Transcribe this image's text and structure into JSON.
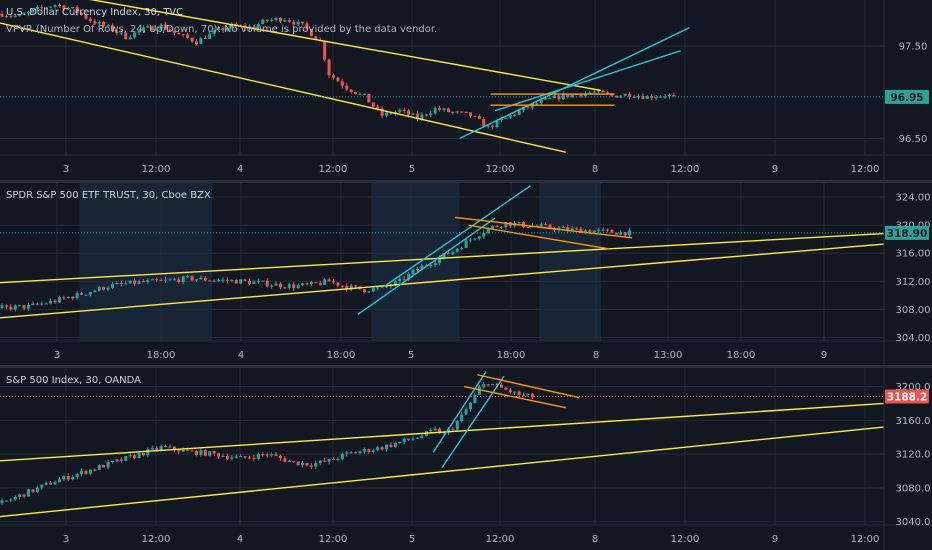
{
  "chart_data": [
    {
      "type": "candlestick",
      "title": "U.S. Dollar Currency Index, 30, TVC",
      "subtitle": "VPVR (Number Of Rows, 24, Up/Down, 70): No volume is provided by the data vendor.",
      "x_tick_labels": [
        "3",
        "12:00",
        "4",
        "12:00",
        "5",
        "12:00",
        "8",
        "12:00",
        "9",
        "12:00"
      ],
      "y_tick_labels": [
        "97.50",
        "96.95",
        "96.50"
      ],
      "y_range": [
        96.32,
        98.0
      ],
      "last_price": "96.95",
      "last_price_value": 96.95,
      "last_price_color": "#26a69a",
      "price_path": [
        [
          0,
          97.85
        ],
        [
          4,
          97.82
        ],
        [
          8,
          97.9
        ],
        [
          12,
          97.95
        ],
        [
          16,
          97.9
        ],
        [
          20,
          97.78
        ],
        [
          24,
          97.7
        ],
        [
          28,
          97.6
        ],
        [
          32,
          97.68
        ],
        [
          36,
          97.72
        ],
        [
          40,
          97.62
        ],
        [
          44,
          97.55
        ],
        [
          48,
          97.65
        ],
        [
          52,
          97.72
        ],
        [
          56,
          97.7
        ],
        [
          60,
          97.78
        ],
        [
          64,
          97.8
        ],
        [
          68,
          97.72
        ],
        [
          72,
          97.55
        ],
        [
          74,
          97.2
        ],
        [
          78,
          97.05
        ],
        [
          82,
          96.95
        ],
        [
          86,
          96.75
        ],
        [
          90,
          96.8
        ],
        [
          94,
          96.72
        ],
        [
          98,
          96.82
        ],
        [
          102,
          96.78
        ],
        [
          106,
          96.75
        ],
        [
          110,
          96.62
        ],
        [
          114,
          96.72
        ],
        [
          118,
          96.82
        ],
        [
          122,
          96.9
        ],
        [
          126,
          96.95
        ],
        [
          130,
          96.98
        ],
        [
          134,
          97.0
        ],
        [
          138,
          96.96
        ],
        [
          142,
          96.98
        ],
        [
          146,
          96.95
        ],
        [
          150,
          96.97
        ],
        [
          152,
          96.95
        ]
      ],
      "trendlines": [
        {
          "color": "#ffeb3b",
          "points": [
            [
              0,
              98.18
            ],
            [
              136,
              97.02
            ]
          ]
        },
        {
          "color": "#ffeb3b",
          "points": [
            [
              0,
              97.75
            ],
            [
              128,
              96.35
            ]
          ]
        },
        {
          "color": "#26c6da",
          "points": [
            [
              104,
              96.5
            ],
            [
              156,
              97.7
            ]
          ]
        },
        {
          "color": "#26c6da",
          "points": [
            [
              112,
              96.8
            ],
            [
              154,
              97.45
            ]
          ]
        },
        {
          "color": "#ff9800",
          "points": [
            [
              111,
              96.98
            ],
            [
              139,
              96.98
            ]
          ]
        },
        {
          "color": "#ff9800",
          "points": [
            [
              111,
              96.86
            ],
            [
              139,
              96.86
            ]
          ]
        }
      ],
      "session_bands": []
    },
    {
      "type": "candlestick",
      "title": "SPDR S&P 500 ETF TRUST, 30, Cboe BZX",
      "x_tick_labels": [
        "3",
        "18:00",
        "4",
        "18:00",
        "5",
        "18:00",
        "8",
        "13:00",
        "18:00",
        "9"
      ],
      "y_tick_labels": [
        "324.00",
        "320.00",
        "318.90",
        "316.00",
        "312.00",
        "308.00",
        "304.00"
      ],
      "y_range": [
        303.5,
        326.0
      ],
      "last_price": "318.90",
      "last_price_value": 318.9,
      "last_price_color": "#26a69a",
      "price_path": [
        [
          0,
          308.2
        ],
        [
          6,
          308.4
        ],
        [
          12,
          309.2
        ],
        [
          18,
          310.2
        ],
        [
          24,
          311.3
        ],
        [
          30,
          311.8
        ],
        [
          36,
          312.0
        ],
        [
          42,
          312.4
        ],
        [
          48,
          312.2
        ],
        [
          54,
          312.0
        ],
        [
          58,
          311.8
        ],
        [
          62,
          311.5
        ],
        [
          66,
          311.3
        ],
        [
          70,
          311.5
        ],
        [
          74,
          312.0
        ],
        [
          78,
          311.2
        ],
        [
          82,
          310.8
        ],
        [
          86,
          311.0
        ],
        [
          90,
          312.0
        ],
        [
          94,
          313.8
        ],
        [
          98,
          315.0
        ],
        [
          102,
          316.3
        ],
        [
          106,
          318.0
        ],
        [
          110,
          319.5
        ],
        [
          114,
          320.3
        ],
        [
          118,
          320.0
        ],
        [
          122,
          319.8
        ],
        [
          126,
          319.5
        ],
        [
          130,
          319.3
        ],
        [
          134,
          319.2
        ],
        [
          138,
          319.0
        ],
        [
          142,
          318.9
        ]
      ],
      "trendlines": [
        {
          "color": "#ffeb3b",
          "points": [
            [
              0,
              311.8
            ],
            [
              200,
              318.8
            ]
          ]
        },
        {
          "color": "#ffeb3b",
          "points": [
            [
              0,
              306.8
            ],
            [
              200,
              317.3
            ]
          ]
        },
        {
          "color": "#26c6da",
          "points": [
            [
              87,
              311.3
            ],
            [
              120,
              325.6
            ]
          ]
        },
        {
          "color": "#26c6da",
          "points": [
            [
              81,
              307.3
            ],
            [
              112,
              321.0
            ]
          ]
        },
        {
          "color": "#ff9800",
          "points": [
            [
              103,
              321.1
            ],
            [
              143,
              318.2
            ]
          ]
        },
        {
          "color": "#ff9800",
          "points": [
            [
              106,
              320.0
            ],
            [
              138,
              316.6
            ]
          ]
        }
      ],
      "session_bands": [
        [
          18,
          48
        ],
        [
          84,
          104
        ],
        [
          122,
          136
        ]
      ]
    },
    {
      "type": "candlestick",
      "title": "S&P 500 Index, 30, OANDA",
      "x_tick_labels": [
        "3",
        "12:00",
        "4",
        "12:00",
        "5",
        "12:00",
        "8",
        "12:00",
        "9",
        "12:00"
      ],
      "y_tick_labels": [
        "3200.0",
        "3188.2",
        "3160.0",
        "3120.0",
        "3080.0",
        "3040.0"
      ],
      "y_range": [
        3036.0,
        3222.0
      ],
      "last_price": "3188.2",
      "last_price_value": 3188.2,
      "last_price_color": "#ef5350",
      "price_path": [
        [
          0,
          3062
        ],
        [
          6,
          3075
        ],
        [
          12,
          3088
        ],
        [
          18,
          3098
        ],
        [
          24,
          3108
        ],
        [
          30,
          3118
        ],
        [
          36,
          3128
        ],
        [
          42,
          3123
        ],
        [
          48,
          3120
        ],
        [
          54,
          3115
        ],
        [
          60,
          3120
        ],
        [
          66,
          3110
        ],
        [
          70,
          3108
        ],
        [
          74,
          3112
        ],
        [
          78,
          3120
        ],
        [
          82,
          3124
        ],
        [
          86,
          3128
        ],
        [
          90,
          3134
        ],
        [
          94,
          3140
        ],
        [
          98,
          3148
        ],
        [
          100,
          3144
        ],
        [
          102,
          3152
        ],
        [
          104,
          3165
        ],
        [
          106,
          3180
        ],
        [
          108,
          3198
        ],
        [
          110,
          3205
        ],
        [
          112,
          3200
        ],
        [
          114,
          3196
        ],
        [
          116,
          3192
        ],
        [
          118,
          3189
        ],
        [
          120,
          3188
        ]
      ],
      "trendlines": [
        {
          "color": "#ffeb3b",
          "points": [
            [
              0,
              3112
            ],
            [
              200,
              3180
            ]
          ]
        },
        {
          "color": "#ffeb3b",
          "points": [
            [
              0,
              3046
            ],
            [
              200,
              3152
            ]
          ]
        },
        {
          "color": "#26c6da",
          "points": [
            [
              98,
              3122
            ],
            [
              110,
              3218
            ]
          ]
        },
        {
          "color": "#26c6da",
          "points": [
            [
              100,
              3104
            ],
            [
              114,
              3212
            ]
          ]
        },
        {
          "color": "#ff9800",
          "points": [
            [
              108,
              3214
            ],
            [
              131,
              3187
            ]
          ]
        },
        {
          "color": "#ff9800",
          "points": [
            [
              105,
              3200
            ],
            [
              128,
              3175
            ]
          ]
        }
      ],
      "session_bands": []
    }
  ]
}
